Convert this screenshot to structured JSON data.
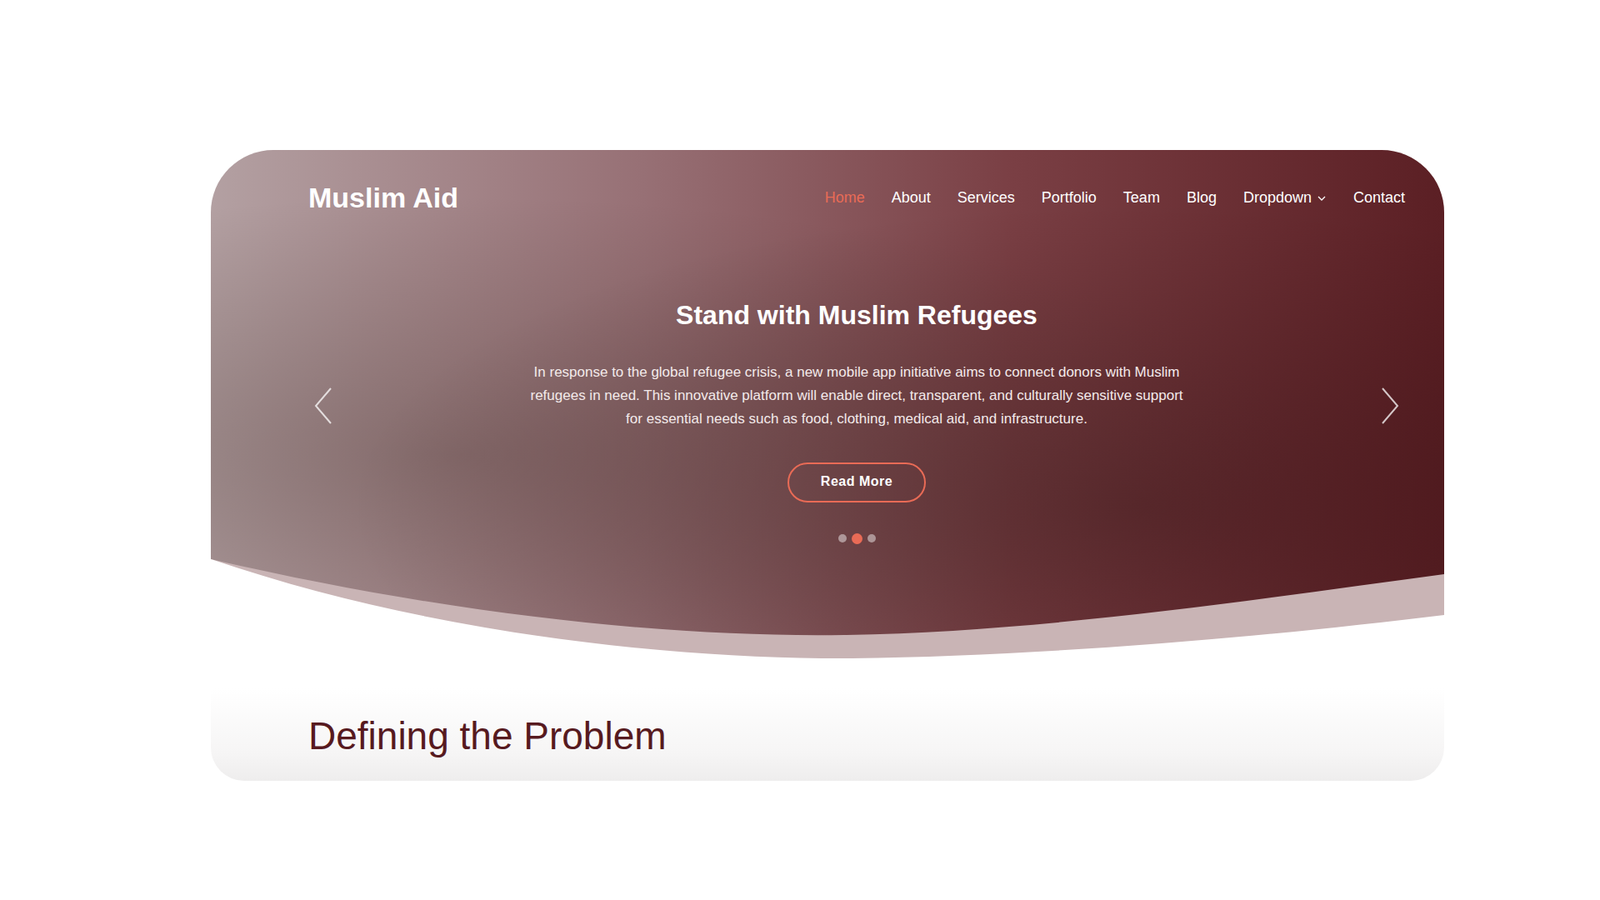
{
  "logo": "Muslim Aid",
  "nav": [
    {
      "label": "Home",
      "selected": true,
      "kind": "link"
    },
    {
      "label": "About",
      "selected": false,
      "kind": "link"
    },
    {
      "label": "Services",
      "selected": false,
      "kind": "link"
    },
    {
      "label": "Portfolio",
      "selected": false,
      "kind": "link"
    },
    {
      "label": "Team",
      "selected": false,
      "kind": "link"
    },
    {
      "label": "Blog",
      "selected": false,
      "kind": "link"
    },
    {
      "label": "Dropdown",
      "selected": false,
      "kind": "dropdown"
    },
    {
      "label": "Contact",
      "selected": false,
      "kind": "link"
    }
  ],
  "hero": {
    "title": "Stand with Muslim Refugees",
    "text": "In response to the global refugee crisis, a new mobile app initiative aims to connect donors with Muslim refugees in need. This innovative platform will enable direct, transparent, and culturally sensitive support for essential needs such as food, clothing, medical aid, and infrastructure.",
    "button": "Read More",
    "dots": [
      {
        "selected": false
      },
      {
        "selected": true
      },
      {
        "selected": false
      }
    ]
  },
  "section": {
    "title": "Defining the Problem"
  }
}
